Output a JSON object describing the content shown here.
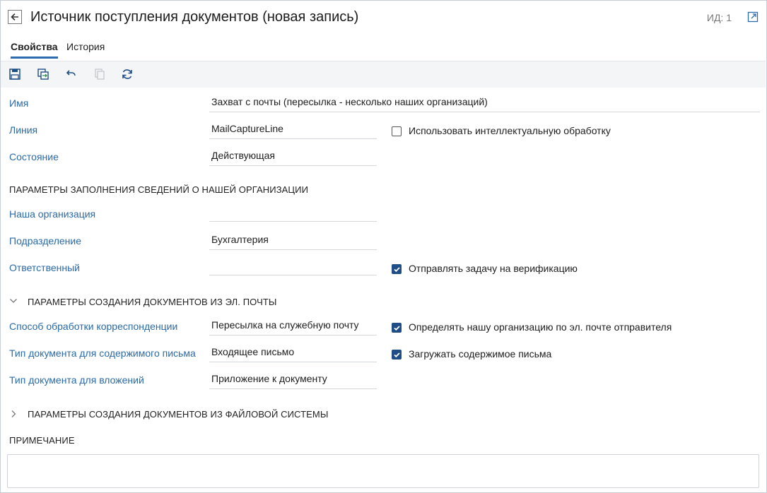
{
  "header": {
    "title": "Источник поступления документов (новая запись)",
    "id_label": "ИД: 1"
  },
  "tabs": [
    {
      "label": "Свойства",
      "active": true
    },
    {
      "label": "История",
      "active": false
    }
  ],
  "toolbar": {
    "buttons": [
      "save-icon",
      "save-and-close-icon",
      "undo-icon",
      "copy-icon",
      "refresh-icon"
    ],
    "accent_color": "#2b6cb0"
  },
  "fields": {
    "name": {
      "label": "Имя",
      "value": "Захват с почты (пересылка - несколько наших организаций)"
    },
    "line": {
      "label": "Линия",
      "value": "MailCaptureLine"
    },
    "state": {
      "label": "Состояние",
      "value": "Действующая"
    },
    "organization": {
      "label": "Наша организация",
      "value": ""
    },
    "department": {
      "label": "Подразделение",
      "value": "Бухгалтерия"
    },
    "responsible": {
      "label": "Ответственный",
      "value": ""
    },
    "processing_method": {
      "label": "Способ обработки корреспонденции",
      "value": "Пересылка на служебную почту"
    },
    "content_doc_type": {
      "label": "Тип документа для содержимого письма",
      "value": "Входящее письмо"
    },
    "attachment_doc_type": {
      "label": "Тип документа для вложений",
      "value": "Приложение к документу"
    }
  },
  "checkboxes": {
    "intelligent_processing": {
      "label": "Использовать интеллектуальную обработку",
      "checked": false
    },
    "send_verification": {
      "label": "Отправлять задачу на верификацию",
      "checked": true
    },
    "detect_org_by_email": {
      "label": "Определять нашу организацию по эл. почте отправителя",
      "checked": true
    },
    "load_content": {
      "label": "Загружать содержимое письма",
      "checked": true
    }
  },
  "sections": {
    "org_params": "ПАРАМЕТРЫ ЗАПОЛНЕНИЯ СВЕДЕНИЙ О НАШЕЙ ОРГАНИЗАЦИИ",
    "email_params": "ПАРАМЕТРЫ СОЗДАНИЯ ДОКУМЕНТОВ ИЗ ЭЛ. ПОЧТЫ",
    "filesystem_params": "ПАРАМЕТРЫ СОЗДАНИЯ ДОКУМЕНТОВ ИЗ ФАЙЛОВОЙ СИСТЕМЫ",
    "note": "ПРИМЕЧАНИЕ"
  },
  "note": {
    "value": ""
  }
}
